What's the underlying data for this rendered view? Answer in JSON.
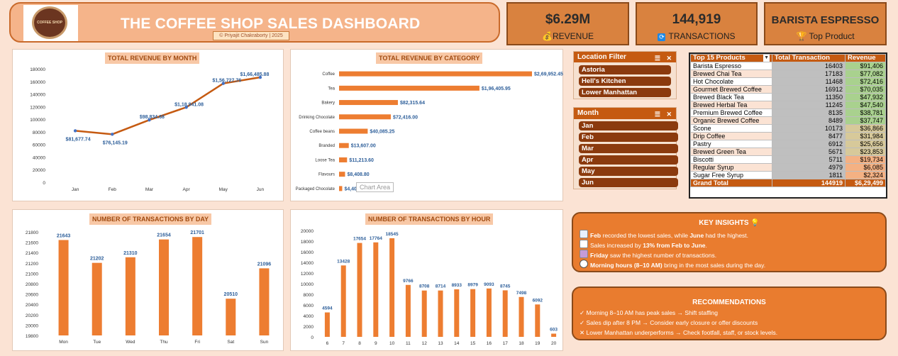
{
  "header": {
    "title": "THE COFFEE SHOP SALES DASHBOARD",
    "author": "© Priyajit Chakraborty | 2025",
    "logo_text": "COFFEE SHOP"
  },
  "kpis": [
    {
      "value": "$6.29M",
      "label": "REVENUE",
      "icon": "moneybag-icon"
    },
    {
      "value": "144,919",
      "label": "TRANSACTIONS",
      "icon": "refresh-icon"
    },
    {
      "value": "BARISTA ESPRESSO",
      "label": "Top Product",
      "icon": "trophy-icon"
    }
  ],
  "revenue_month": {
    "title": "TOTAL REVENUE BY MONTH",
    "chart_data": {
      "type": "line",
      "categories": [
        "Jan",
        "Feb",
        "Mar",
        "Apr",
        "May",
        "Jun"
      ],
      "values": [
        81677.74,
        76145.19,
        98834.68,
        118941.08,
        156727.76,
        166485.88
      ],
      "labels": [
        "$81,677.74",
        "$76,145.19",
        "$98,834.68",
        "$1,18,941.08",
        "$1,56,727.76",
        "$1,66,485.88"
      ],
      "yticks": [
        "0",
        "20000",
        "40000",
        "60000",
        "80000",
        "100000",
        "120000",
        "140000",
        "160000",
        "180000"
      ],
      "ylim": [
        0,
        180000
      ],
      "color": "#c55a11"
    }
  },
  "revenue_category": {
    "title": "TOTAL REVENUE BY CATEGORY",
    "chart_data": {
      "type": "bar",
      "categories": [
        "Coffee",
        "Tea",
        "Bakery",
        "Drinking Chocolate",
        "Coffee beans",
        "Branded",
        "Loose Tea",
        "Flavours",
        "Packaged Chocolate"
      ],
      "values": [
        269952.45,
        196405.95,
        82315.64,
        72416.0,
        40085.25,
        13607.0,
        11213.6,
        8408.8,
        4407.64
      ],
      "labels": [
        "$2,69,952.45",
        "$1,96,405.95",
        "$82,315.64",
        "$72,416.00",
        "$40,085.25",
        "$13,607.00",
        "$11,213.60",
        "$8,408.80",
        "$4,407.64"
      ],
      "color": "#ed7d31"
    },
    "overlay": "Chart Area"
  },
  "trans_day": {
    "title": "NUMBER OF TRANSACTIONS BY DAY",
    "chart_data": {
      "type": "bar",
      "categories": [
        "Mon",
        "Tue",
        "Wed",
        "Thu",
        "Fri",
        "Sat",
        "Sun"
      ],
      "values": [
        21643,
        21202,
        21310,
        21654,
        21701,
        20510,
        21096
      ],
      "yticks": [
        "19800",
        "20000",
        "20200",
        "20400",
        "20600",
        "20800",
        "21000",
        "21200",
        "21400",
        "21600",
        "21800"
      ],
      "ylim": [
        19800,
        21800
      ],
      "color": "#ed7d31"
    }
  },
  "trans_hour": {
    "title": "NUMBER OF TRANSACTIONS BY HOUR",
    "chart_data": {
      "type": "bar",
      "categories": [
        "6",
        "7",
        "8",
        "9",
        "10",
        "11",
        "12",
        "13",
        "14",
        "15",
        "16",
        "17",
        "18",
        "19",
        "20"
      ],
      "values": [
        4594,
        13428,
        17654,
        17764,
        18545,
        9766,
        8708,
        8714,
        8933,
        8979,
        9093,
        8745,
        7498,
        6092,
        603
      ],
      "yticks": [
        "0",
        "2000",
        "4000",
        "6000",
        "8000",
        "10000",
        "12000",
        "14000",
        "16000",
        "18000",
        "20000"
      ],
      "ylim": [
        0,
        20000
      ],
      "color": "#ed7d31"
    }
  },
  "location_filter": {
    "title": "Location Filter",
    "items": [
      "Astoria",
      "Hell's Kitchen",
      "Lower Manhattan"
    ]
  },
  "month_filter": {
    "title": "Month",
    "items": [
      "Jan",
      "Feb",
      "Mar",
      "Apr",
      "May",
      "Jun"
    ]
  },
  "products": {
    "headers": [
      "Top 15 Products",
      "Total Transaction",
      "Revenue"
    ],
    "rows": [
      [
        "Barista Espresso",
        "16403",
        "$91,406"
      ],
      [
        "Brewed Chai Tea",
        "17183",
        "$77,082"
      ],
      [
        "Hot Chocolate",
        "11468",
        "$72,416"
      ],
      [
        "Gourmet Brewed Coffee",
        "16912",
        "$70,035"
      ],
      [
        "Brewed Black Tea",
        "11350",
        "$47,932"
      ],
      [
        "Brewed Herbal Tea",
        "11245",
        "$47,540"
      ],
      [
        "Premium Brewed Coffee",
        "8135",
        "$38,781"
      ],
      [
        "Organic Brewed Coffee",
        "8489",
        "$37,747"
      ],
      [
        "Scone",
        "10173",
        "$36,866"
      ],
      [
        "Drip Coffee",
        "8477",
        "$31,984"
      ],
      [
        "Pastry",
        "6912",
        "$25,656"
      ],
      [
        "Brewed Green Tea",
        "5671",
        "$23,853"
      ],
      [
        "Biscotti",
        "5711",
        "$19,734"
      ],
      [
        "Regular Syrup",
        "4979",
        "$6,085"
      ],
      [
        "Sugar Free Syrup",
        "1811",
        "$2,324"
      ]
    ],
    "total": [
      "Grand Total",
      "144919",
      "$6,29,499"
    ]
  },
  "insights": {
    "title": "KEY INSIGHTS",
    "lines": [
      {
        "b1": "Feb",
        "t1": " recorded the lowest sales, while ",
        "b2": "June",
        "t2": " had the highest."
      },
      {
        "b1": "",
        "t1": "Sales increased by ",
        "b2": "13% from Feb to June",
        "t2": "."
      },
      {
        "b1": "Friday",
        "t1": " saw the highest number of transactions.",
        "b2": "",
        "t2": ""
      },
      {
        "b1": "Morning hours (8–10 AM)",
        "t1": " bring in the most sales during the day.",
        "b2": "",
        "t2": ""
      }
    ]
  },
  "recommendations": {
    "title": "RECOMMENDATIONS",
    "lines": [
      "✓ Morning 8–10 AM has peak sales → Shift staffing",
      "✓ Sales dip after 8 PM → Consider early closure or offer discounts",
      "✕ Lower Manhattan underperforms → Check footfall, staff, or stock levels."
    ]
  }
}
